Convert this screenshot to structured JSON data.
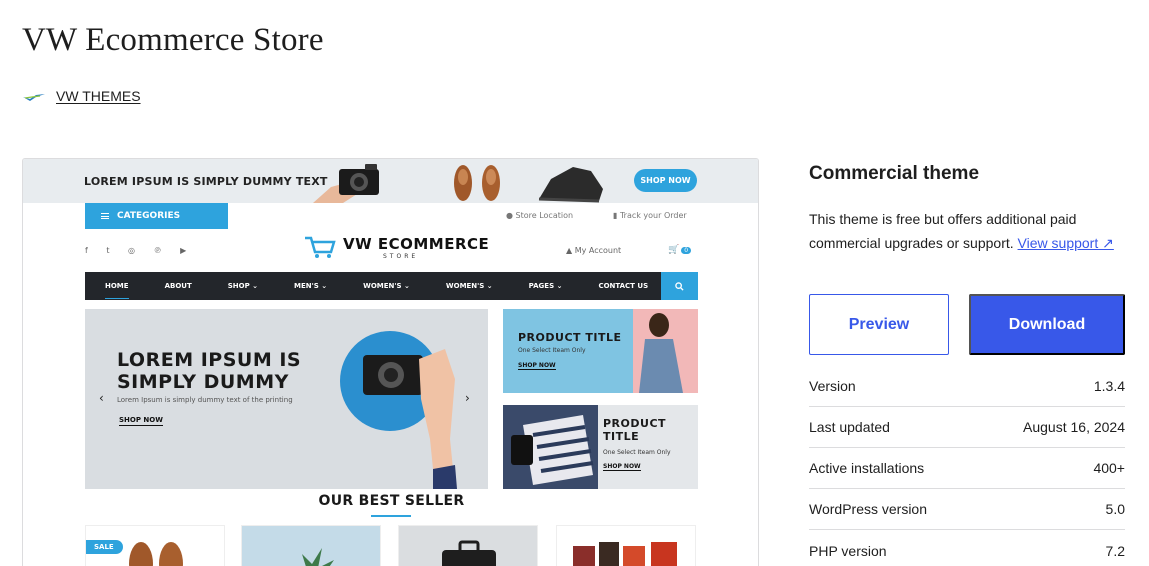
{
  "page": {
    "title": "VW Ecommerce Store",
    "author": "VW THEMES"
  },
  "preview": {
    "topbar_text": "LOREM IPSUM IS SIMPLY DUMMY TEXT",
    "topbar_button": "SHOP NOW",
    "categories": "CATEGORIES",
    "store_location": "Store Location",
    "track_order": "Track your Order",
    "logo_name": "VW ECOMMERCE",
    "logo_sub": "STORE",
    "account": "My Account",
    "cart_count": "0",
    "nav": [
      "HOME",
      "ABOUT",
      "SHOP ⌄",
      "MEN'S ⌄",
      "WOMEN'S ⌄",
      "WOMEN'S ⌄",
      "PAGES ⌄",
      "CONTACT US"
    ],
    "hero_title": "LOREM IPSUM IS SIMPLY DUMMY",
    "hero_sub": "Lorem Ipsum is simply dummy text of the printing",
    "hero_button": "SHOP NOW",
    "promo1_title": "PRODUCT TITLE",
    "promo1_sub": "One  Select Iteam Only",
    "promo1_button": "SHOP NOW",
    "promo2_title": "PRODUCT TITLE",
    "promo2_sub": "One  Select Iteam Only",
    "promo2_button": "SHOP NOW",
    "section_title": "OUR BEST SELLER",
    "sale_badge": "SALE"
  },
  "sidebar": {
    "heading": "Commercial theme",
    "desc": "This theme is free but offers additional paid commercial upgrades or support.",
    "link": "View support ↗",
    "preview_button": "Preview",
    "download_button": "Download",
    "meta": [
      {
        "label": "Version",
        "value": "1.3.4"
      },
      {
        "label": "Last updated",
        "value": "August 16, 2024"
      },
      {
        "label": "Active installations",
        "value": "400+"
      },
      {
        "label": "WordPress version",
        "value": "5.0"
      },
      {
        "label": "PHP version",
        "value": "7.2"
      }
    ]
  },
  "colors": {
    "accent": "#3858e9",
    "theme_blue": "#2ea3dd",
    "nav_dark": "#23262b"
  }
}
